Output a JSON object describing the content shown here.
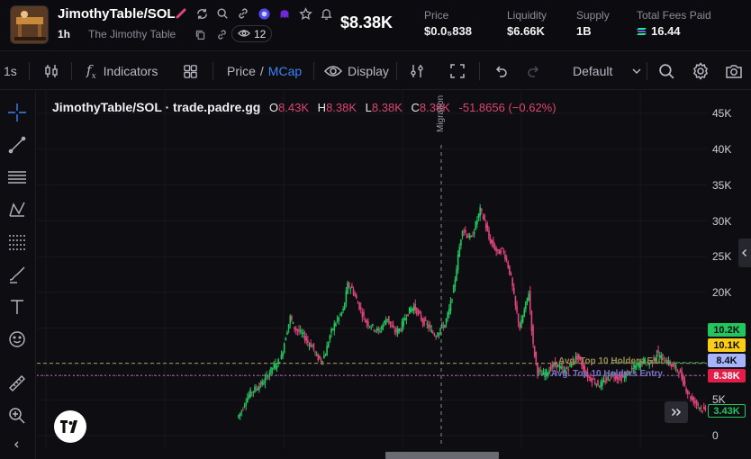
{
  "token": {
    "symbol": "JimothyTable/SOL",
    "timeframe": "1h",
    "full_name": "The Jimothy Table",
    "views": "12",
    "price": "$8.38K"
  },
  "stats": [
    {
      "label": "Price",
      "value": "$0.0₅838"
    },
    {
      "label": "Liquidity",
      "value": "$6.66K"
    },
    {
      "label": "Supply",
      "value": "1B"
    },
    {
      "label": "Total Fees Paid",
      "value": "16.44"
    }
  ],
  "toolbar": {
    "interval": "1s",
    "indicators": "Indicators",
    "price": "Price",
    "slash": "/",
    "mcap": "MCap",
    "display": "Display",
    "layout": "Default"
  },
  "legend": {
    "pair": "JimothyTable/SOL · trade.padre.gg",
    "o_label": "O",
    "o": "8.43K",
    "h_label": "H",
    "h": "8.38K",
    "l_label": "L",
    "l": "8.38K",
    "c_label": "C",
    "c": "8.38K",
    "change": "-51.8656 (−0.62%)"
  },
  "annotations": {
    "migration": "Migration",
    "top10_exit": "Avg. Top 10 Holders Exit",
    "top10_entry": "Avg. Top 10 Holders Entry"
  },
  "axis_labels": [
    "45K",
    "40K",
    "35K",
    "30K",
    "25K",
    "20K",
    "5K",
    "0"
  ],
  "tags": [
    {
      "value": "10.2K",
      "bg": "#22c55e",
      "fg": "#0b0b0e"
    },
    {
      "value": "10.1K",
      "bg": "#facc15",
      "fg": "#0b0b0e"
    },
    {
      "value": "8.4K",
      "bg": "#a5b4fc",
      "fg": "#0b0b0e"
    },
    {
      "value": "8.38K",
      "bg": "#e11d48",
      "fg": "#ffffff"
    },
    {
      "value": "3.43K",
      "bg": "#0e0e12",
      "fg": "#22c55e"
    }
  ],
  "colors": {
    "up": "#22c55e",
    "down": "#e0457a",
    "accent": "#3b82f6"
  },
  "chart_data": {
    "type": "candlestick",
    "ylim": [
      0,
      45000
    ],
    "grid": true,
    "title": "JimothyTable/SOL · trade.padre.gg",
    "series": [
      {
        "name": "MCap",
        "values": [
          2500,
          3500,
          5000,
          6000,
          6500,
          7000,
          7500,
          8500,
          9500,
          10000,
          11000,
          14000,
          16500,
          15000,
          14500,
          14000,
          13000,
          12500,
          11000,
          10500,
          11500,
          14000,
          15500,
          16500,
          17500,
          21000,
          20500,
          19000,
          17500,
          16000,
          15500,
          15000,
          14500,
          15500,
          16500,
          15000,
          14500,
          15000,
          16500,
          17500,
          18000,
          17000,
          16000,
          15500,
          14500,
          14000,
          15000,
          15500,
          17500,
          20500,
          25000,
          29000,
          28000,
          27500,
          29500,
          31500,
          30000,
          27500,
          26500,
          25500,
          26000,
          24500,
          22000,
          18000,
          15000,
          17500,
          20000,
          12500,
          9000,
          8500,
          8800,
          9500,
          10000,
          9500,
          9000,
          9500,
          10500,
          11000,
          10000,
          8500,
          8000,
          7500,
          7000,
          7500,
          8000,
          8500,
          8200,
          8000,
          8500,
          9000,
          9500,
          10000,
          10500,
          10000,
          10500,
          11500,
          11000,
          10500,
          10000,
          9500,
          9000,
          7500,
          6000,
          5000,
          4500,
          3800,
          3430
        ]
      }
    ]
  }
}
